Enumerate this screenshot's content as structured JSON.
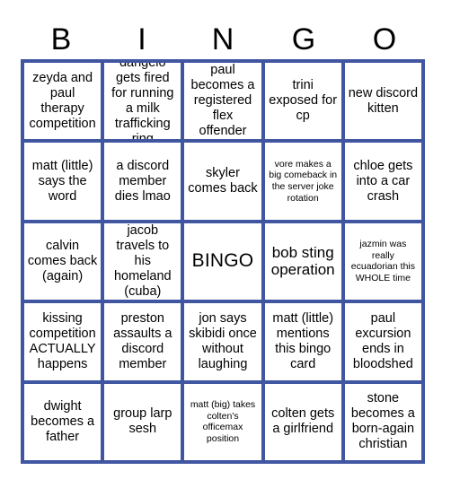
{
  "card": {
    "title": "BINGO",
    "header_letters": [
      "B",
      "I",
      "N",
      "G",
      "O"
    ],
    "grid_color": "#4056a1",
    "text_color": "#000000",
    "background_color": "#ffffff",
    "columns": 5,
    "rows": 5,
    "cells": [
      {
        "text": "zeyda and paul therapy competition",
        "size": "normal"
      },
      {
        "text": "dangelo gets fired for running a milk trafficking ring",
        "size": "normal"
      },
      {
        "text": "paul becomes a registered flex offender",
        "size": "normal"
      },
      {
        "text": "trini exposed for cp",
        "size": "normal"
      },
      {
        "text": "new discord kitten",
        "size": "normal"
      },
      {
        "text": "matt (little) says the word",
        "size": "normal"
      },
      {
        "text": "a discord member dies lmao",
        "size": "normal"
      },
      {
        "text": "skyler comes back",
        "size": "normal"
      },
      {
        "text": "vore makes a big comeback in the server joke rotation",
        "size": "small"
      },
      {
        "text": "chloe gets into a car crash",
        "size": "normal"
      },
      {
        "text": "calvin comes back (again)",
        "size": "normal"
      },
      {
        "text": "jacob travels to his homeland (cuba)",
        "size": "normal"
      },
      {
        "text": "BINGO",
        "size": "free"
      },
      {
        "text": "bob sting operation",
        "size": "large"
      },
      {
        "text": "jazmin was really ecuadorian this WHOLE time",
        "size": "small"
      },
      {
        "text": "kissing competition ACTUALLY happens",
        "size": "normal"
      },
      {
        "text": "preston assaults a discord member",
        "size": "normal"
      },
      {
        "text": "jon says skibidi once without laughing",
        "size": "normal"
      },
      {
        "text": "matt (little) mentions this bingo card",
        "size": "normal"
      },
      {
        "text": "paul excursion ends in bloodshed",
        "size": "normal"
      },
      {
        "text": "dwight becomes a father",
        "size": "normal"
      },
      {
        "text": "group larp sesh",
        "size": "normal"
      },
      {
        "text": "matt (big) takes colten's officemax position",
        "size": "small"
      },
      {
        "text": "colten gets a girlfriend",
        "size": "normal"
      },
      {
        "text": "stone becomes a born-again christian",
        "size": "normal"
      }
    ]
  }
}
